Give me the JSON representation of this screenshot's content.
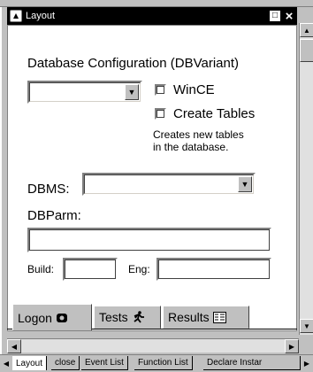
{
  "window": {
    "title": "Layout",
    "minimize_glyph": "□",
    "close_glyph": "×"
  },
  "form": {
    "heading": "Database Configuration (DBVariant)",
    "dbvariant_value": "",
    "wince_label": "WinCE",
    "create_tables_label": "Create Tables",
    "create_tables_note_line1": "Creates new tables",
    "create_tables_note_line2": "in the database.",
    "dbms_label": "DBMS:",
    "dbms_value": "",
    "dbparm_label": "DBParm:",
    "dbparm_value": "",
    "build_label": "Build:",
    "build_value": "",
    "eng_label": "Eng:",
    "eng_value": ""
  },
  "tabs": [
    {
      "label": "Logon",
      "icon": "logon-icon",
      "active": true
    },
    {
      "label": "Tests",
      "icon": "runner-icon",
      "active": false
    },
    {
      "label": "Results",
      "icon": "results-icon",
      "active": false
    }
  ],
  "sheet_tabs": [
    {
      "label": "Layout",
      "active": true
    },
    {
      "label": "close",
      "active": false
    },
    {
      "label": "Event List",
      "active": false
    },
    {
      "label": "Function List",
      "active": false
    },
    {
      "label": "Declare Instar",
      "active": false
    }
  ],
  "colors": {
    "window_face": "#c0c0c0",
    "titlebar": "#000000",
    "panel": "#ffffff"
  }
}
